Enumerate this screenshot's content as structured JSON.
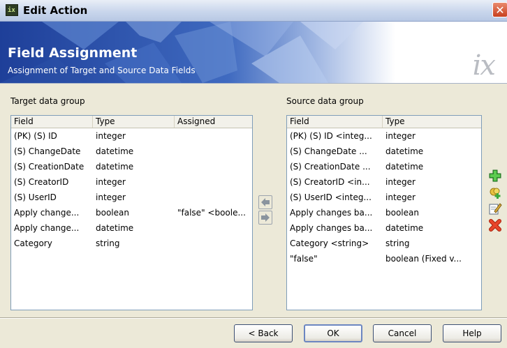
{
  "window": {
    "title": "Edit Action",
    "app_icon_glyph": "ix",
    "close_glyph": "✕"
  },
  "banner": {
    "title": "Field Assignment",
    "subtitle": "Assignment of Target and Source Data Fields",
    "logo": "ix"
  },
  "target": {
    "label": "Target data group",
    "columns": [
      "Field",
      "Type",
      "Assigned"
    ],
    "rows": [
      {
        "field": "(PK) (S) ID",
        "type": "integer",
        "assigned": ""
      },
      {
        "field": "(S) ChangeDate",
        "type": "datetime",
        "assigned": ""
      },
      {
        "field": "(S) CreationDate",
        "type": "datetime",
        "assigned": ""
      },
      {
        "field": "(S) CreatorID",
        "type": "integer",
        "assigned": ""
      },
      {
        "field": "(S) UserID",
        "type": "integer",
        "assigned": ""
      },
      {
        "field": "Apply change...",
        "type": "boolean",
        "assigned": "\"false\" <boole..."
      },
      {
        "field": "Apply change...",
        "type": "datetime",
        "assigned": ""
      },
      {
        "field": "Category",
        "type": "string",
        "assigned": ""
      }
    ]
  },
  "source": {
    "label": "Source data group",
    "columns": [
      "Field",
      "Type"
    ],
    "rows": [
      {
        "field": "(PK) (S) ID <integ...",
        "type": "integer"
      },
      {
        "field": "(S) ChangeDate ...",
        "type": "datetime"
      },
      {
        "field": "(S) CreationDate ...",
        "type": "datetime"
      },
      {
        "field": "(S) CreatorID <in...",
        "type": "integer"
      },
      {
        "field": "(S) UserID <integ...",
        "type": "integer"
      },
      {
        "field": "Apply changes ba...",
        "type": "boolean"
      },
      {
        "field": "Apply changes ba...",
        "type": "datetime"
      },
      {
        "field": "Category <string>",
        "type": "string"
      },
      {
        "field": "\"false\"",
        "type": "boolean (Fixed v..."
      }
    ]
  },
  "icons": {
    "assign_left": "arrow-left-icon",
    "assign_right": "arrow-right-icon",
    "add": "add-icon",
    "add_fixed": "add-fixed-value-icon",
    "edit": "edit-icon",
    "delete": "delete-icon"
  },
  "buttons": {
    "back": "< Back",
    "ok": "OK",
    "cancel": "Cancel",
    "help": "Help"
  },
  "colors": {
    "banner_blue": "#2a4ea5",
    "add_green": "#3aa83a",
    "delete_red": "#d0301c"
  }
}
